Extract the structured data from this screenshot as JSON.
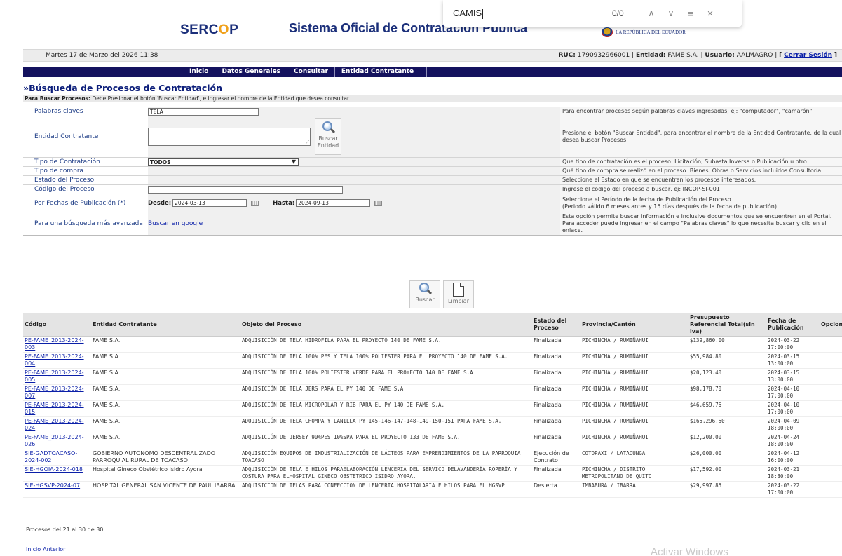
{
  "header": {
    "logo_prefix": "SERC",
    "logo_o": "O",
    "logo_suffix": "P",
    "title": "Sistema Oficial de Contratación Pública",
    "republica": "LA REPÚBLICA DEL ECUADOR"
  },
  "findbar": {
    "query": "CAMIS",
    "count": "0/0",
    "up_icon": "chevron-up",
    "down_icon": "chevron-down",
    "menu_icon": "menu",
    "close_icon": "close"
  },
  "datebar": {
    "date": "Martes 17 de Marzo del 2026 11:38",
    "ruc_label": "RUC:",
    "ruc": "1790932966001",
    "entidad_label": "Entidad:",
    "entidad": "FAME S.A.",
    "usuario_label": "Usuario:",
    "usuario": "AALMAGRO",
    "cerrar": "Cerrar Sesión"
  },
  "nav": {
    "items": [
      "Inicio",
      "Datos Generales",
      "Consultar",
      "Entidad Contratante"
    ]
  },
  "page_title": "»Búsqueda de Procesos de Contratación",
  "instructions": {
    "bold": "Para Buscar Procesos:",
    "text": " Debe Presionar el botón 'Buscar Entidad', e ingresar el nombre de la Entidad que desea consultar."
  },
  "form": {
    "palabras": {
      "label": "Palabras claves",
      "value": "TELA",
      "help": "Para encontrar procesos según palabras claves ingresadas; ej: \"computador\", \"camarón\"."
    },
    "entidad": {
      "label": "Entidad Contratante",
      "button": "Buscar Entidad",
      "help": "Presione el botón \"Buscar Entidad\", para encontrar el nombre de la Entidad Contratante, de la cual desea buscar Procesos."
    },
    "tipo_contratacion": {
      "label": "Tipo de Contratación",
      "value": "TODOS",
      "help": "Que tipo de contratación es el proceso: Licitación, Subasta Inversa o Publicación u otro."
    },
    "tipo_compra": {
      "label": "Tipo de compra",
      "help": "Qué tipo de compra se realizó en el proceso: Bienes, Obras o Servicios incluidos Consultoría"
    },
    "estado": {
      "label": "Estado del Proceso",
      "help": "Seleccione el Estado en que se encuentren los procesos interesados."
    },
    "codigo": {
      "label": "Código del Proceso",
      "help": "Ingrese el código del proceso a buscar, ej: INCOP-SI-001"
    },
    "fechas": {
      "label": "Por Fechas de Publicación (*)",
      "desde_label": "Desde:",
      "desde": "2024-03-13",
      "hasta_label": "Hasta:",
      "hasta": "2024-09-13",
      "help1": "Seleccione el Período de la fecha de Publicación del Proceso.",
      "help2": "(Periodo válido 6 meses antes y 15 días después de la fecha de publicación)"
    },
    "avanzada": {
      "label": "Para una búsqueda más avanzada",
      "link": "Buscar en google",
      "help": "Esta opción permite buscar información e inclusive documentos que se encuentren en el Portal. Para acceder puede ingresar en el campo \"Palabras claves\" lo que necesita buscar y clic en el enlace."
    }
  },
  "actions": {
    "buscar": "Buscar",
    "limpiar": "Limpiar"
  },
  "table": {
    "headers": [
      "Código",
      "Entidad Contratante",
      "Objeto del Proceso",
      "Estado del Proceso",
      "Provincia/Cantón",
      "Presupuesto Referencial Total(sin iva)",
      "Fecha de Publicación",
      "Opciones"
    ],
    "rows": [
      {
        "code": "PE-FAME_2013-2024-003",
        "entity": "FAME S.A.",
        "object": "ADQUISICIÓN DE TELA HIDROFILA PARA EL PROYECTO 140 DE FAME S.A.",
        "status": "Finalizada",
        "province": "PICHINCHA / RUMIÑAHUI",
        "budget": "$139,860.00",
        "date": "2024-03-22 17:00:00"
      },
      {
        "code": "PE-FAME_2013-2024-004",
        "entity": "FAME S.A.",
        "object": "ADQUISICIÓN DE TELA 100% PES Y TELA 100% POLIESTER PARA EL PROYECTO 140 DE FAME S.A.",
        "status": "Finalizada",
        "province": "PICHINCHA / RUMIÑAHUI",
        "budget": "$55,984.80",
        "date": "2024-03-15 13:00:00"
      },
      {
        "code": "PE-FAME_2013-2024-005",
        "entity": "FAME S.A.",
        "object": "ADQUISICIÓN DE TELA 100% POLIESTER VERDE PARA EL PROYECTO 140 DE FAME S.A",
        "status": "Finalizada",
        "province": "PICHINCHA / RUMIÑAHUI",
        "budget": "$20,123.40",
        "date": "2024-03-15 13:00:00"
      },
      {
        "code": "PE-FAME_2013-2024-007",
        "entity": "FAME S.A.",
        "object": "ADQUISICIÓN DE TELA JERS PARA EL PY 140 DE FAME S.A.",
        "status": "Finalizada",
        "province": "PICHINCHA / RUMIÑAHUI",
        "budget": "$98,178.70",
        "date": "2024-04-10 17:00:00"
      },
      {
        "code": "PE-FAME_2013-2024-015",
        "entity": "FAME S.A.",
        "object": "ADQUISICIÓN DE TELA MICROPOLAR Y RIB PARA EL PY 140 DE FAME S.A.",
        "status": "Finalizada",
        "province": "PICHINCHA / RUMIÑAHUI",
        "budget": "$46,659.76",
        "date": "2024-04-10 17:00:00"
      },
      {
        "code": "PE-FAME_2013-2024-024",
        "entity": "FAME S.A.",
        "object": "ADQUISICIÓN DE TELA CHOMPA Y LANILLA PY 145-146-147-148-149-150-151 PARA FAME S.A.",
        "status": "Finalizada",
        "province": "PICHINCHA / RUMIÑAHUI",
        "budget": "$165,296.50",
        "date": "2024-04-09 18:00:00"
      },
      {
        "code": "PE-FAME_2013-2024-026",
        "entity": "FAME S.A.",
        "object": "ADQUISICIÓN DE JERSEY 90%PES 10%SPA PARA EL PROYECTO 133 DE FAME S.A.",
        "status": "Finalizada",
        "province": "PICHINCHA / RUMIÑAHUI",
        "budget": "$12,200.00",
        "date": "2024-04-24 18:00:00"
      },
      {
        "code": "SIE-GADTOACASO-2024-002",
        "entity": "GOBIERNO AUTONOMO DESCENTRALIZADO PARROQUIAL RURAL DE TOACASO",
        "object": "ADQUISICIÓN EQUIPOS DE INDUSTRIALIZACIÓN DE LÁCTEOS PARA EMPRENDIMIENTOS DE LA PARROQUIA TOACASO",
        "status": "Ejecución de Contrato",
        "province": "COTOPAXI / LATACUNGA",
        "budget": "$26,000.00",
        "date": "2024-04-12 16:00:00"
      },
      {
        "code": "SIE-HGOIA-2024-018",
        "entity": "Hospital Gíneco Obstétrico Isidro Ayora",
        "object": "ADQUISICIÓN DE TELA E HILOS PARAELABORACIÓN LENCERIA DEL SERVICO DELAVANDERÍA ROPERÍA Y COSTURA PARA ELHOSPITAL GINECO OBSTETRICO ISIDRO AYORA.",
        "status": "Finalizada",
        "province": "PICHINCHA / DISTRITO METROPOLITANO DE QUITO",
        "budget": "$17,592.00",
        "date": "2024-03-21 18:30:00"
      },
      {
        "code": "SIE-HGSVP-2024-07",
        "entity": "HOSPITAL GENERAL SAN VICENTE DE PAUL IBARRA",
        "object": "ADQUISICION DE TELAS PARA CONFECCION DE LENCERIA HOSPITALARIA E HILOS PARA EL HGSVP",
        "status": "Desierta",
        "province": "IMBABURA / IBARRA",
        "budget": "$29,997.85",
        "date": "2024-03-22 17:00:00"
      }
    ]
  },
  "pager": {
    "summary": "Procesos del 21 al 30 de 30",
    "inicio": "Inicio",
    "anterior": "Anterior"
  },
  "watermark": "Activar Windows"
}
